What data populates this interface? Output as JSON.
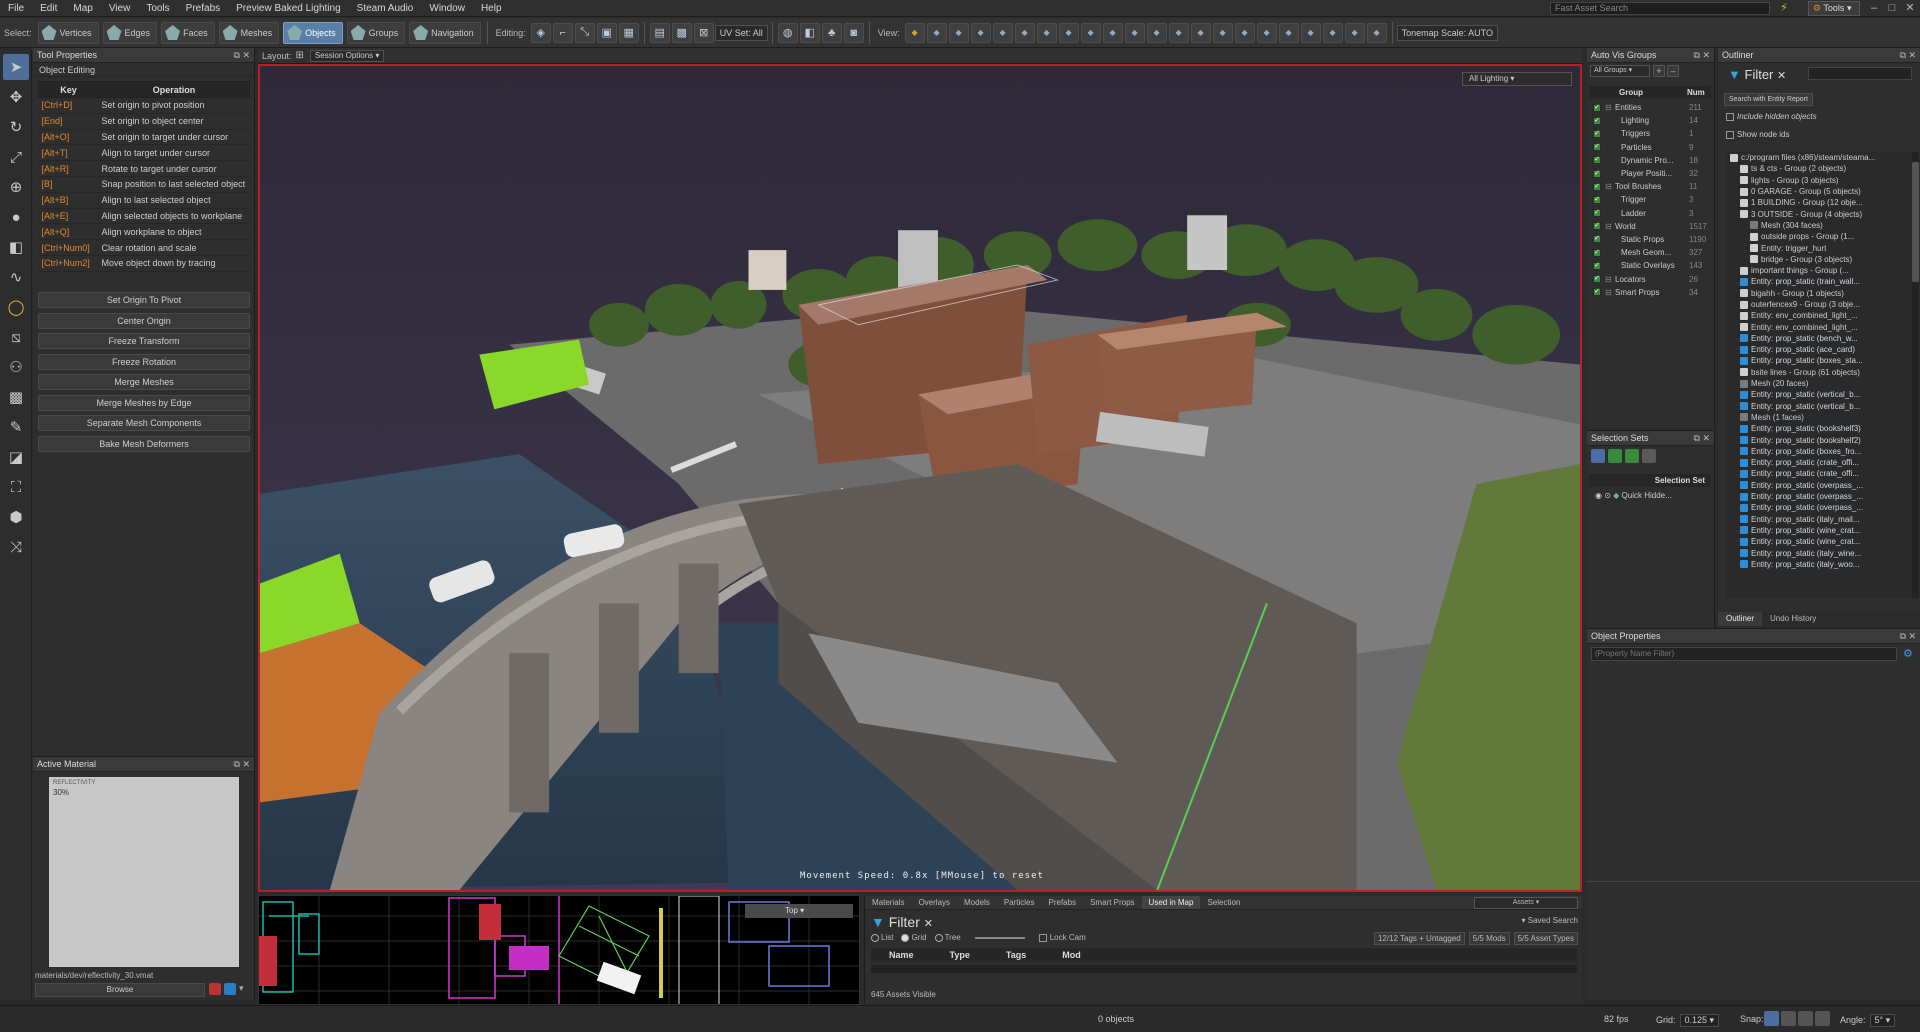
{
  "menu": [
    "File",
    "Edit",
    "Map",
    "View",
    "Tools",
    "Prefabs",
    "Preview Baked Lighting",
    "Steam Audio",
    "Window",
    "Help"
  ],
  "fast_search_placeholder": "Fast Asset Search",
  "tools_label": "Tools",
  "toolbar": {
    "select_label": "Select:",
    "modes": [
      "Vertices",
      "Edges",
      "Faces",
      "Meshes",
      "Objects",
      "Groups",
      "Navigation"
    ],
    "active_mode": "Objects",
    "editing_label": "Editing:",
    "uv_set": "UV Set: All",
    "view_label": "View:",
    "tonemap": "Tonemap Scale: AUTO"
  },
  "tool_properties": {
    "title": "Tool Properties",
    "section": "Object Editing",
    "key_header": "Key",
    "op_header": "Operation",
    "rows": [
      {
        "key": "[Ctrl+D]",
        "op": "Set origin to pivot position"
      },
      {
        "key": "[End]",
        "op": "Set origin to object center"
      },
      {
        "key": "[Alt+O]",
        "op": "Set origin to target under cursor"
      },
      {
        "key": "[Alt+T]",
        "op": "Align to target under cursor"
      },
      {
        "key": "[Alt+R]",
        "op": "Rotate to target under cursor"
      },
      {
        "key": "[B]",
        "op": "Snap position to last selected object"
      },
      {
        "key": "[Alt+B]",
        "op": "Align to last selected object"
      },
      {
        "key": "[Alt+E]",
        "op": "Align selected objects to workplane"
      },
      {
        "key": "[Alt+Q]",
        "op": "Align workplane to object"
      },
      {
        "key": "[Ctrl+Num0]",
        "op": "Clear rotation and scale"
      },
      {
        "key": "[Ctrl+Num2]",
        "op": "Move object down by tracing"
      }
    ],
    "buttons": [
      "Set Origin To Pivot",
      "Center Origin",
      "Freeze Transform",
      "Freeze Rotation",
      "Merge Meshes",
      "Merge Meshes by Edge",
      "Separate Mesh Components",
      "Bake Mesh Deformers"
    ]
  },
  "active_material": {
    "title": "Active Material",
    "preview_name": "REFLECTIVITY",
    "preview_value": "30%",
    "path": "materials/dev/reflectivity_30.vmat",
    "browse": "Browse"
  },
  "viewport": {
    "layout_label": "Layout:",
    "session_options": "Session Options",
    "lighting_mode": "All Lighting",
    "movement_text": "Movement Speed: 0.8x  [MMouse] to reset"
  },
  "minimap": {
    "view": "Top"
  },
  "assets": {
    "tabs": [
      "Materials",
      "Overlays",
      "Models",
      "Particles",
      "Prefabs",
      "Smart Props",
      "Used in Map",
      "Selection"
    ],
    "active_tab": "Used in Map",
    "dropdown": "Assets",
    "filter_label": "Filter",
    "saved_search": "Saved Search",
    "view_modes": [
      "List",
      "Grid",
      "Tree"
    ],
    "lock_cam": "Lock Cam",
    "tags": "12/12 Tags + Untagged",
    "mods": "5/5 Mods",
    "types": "5/5 Asset Types",
    "columns": [
      "Name",
      "Type",
      "Tags",
      "Mod"
    ],
    "count": "645 Assets Visible"
  },
  "auto_vis": {
    "title": "Auto Vis Groups",
    "dropdown": "All Groups",
    "col_group": "Group",
    "col_num": "Num",
    "rows": [
      {
        "name": "Entities",
        "num": "211",
        "indent": 0
      },
      {
        "name": "Lighting",
        "num": "14",
        "indent": 1
      },
      {
        "name": "Triggers",
        "num": "1",
        "indent": 1
      },
      {
        "name": "Particles",
        "num": "9",
        "indent": 1
      },
      {
        "name": "Dynamic Pro...",
        "num": "18",
        "indent": 1
      },
      {
        "name": "Player Positi...",
        "num": "32",
        "indent": 1
      },
      {
        "name": "Tool Brushes",
        "num": "11",
        "indent": 0
      },
      {
        "name": "Trigger",
        "num": "3",
        "indent": 1
      },
      {
        "name": "Ladder",
        "num": "3",
        "indent": 1
      },
      {
        "name": "World",
        "num": "1517",
        "indent": 0
      },
      {
        "name": "Static Props",
        "num": "1190",
        "indent": 1
      },
      {
        "name": "Mesh Geom...",
        "num": "327",
        "indent": 1
      },
      {
        "name": "Static Overlays",
        "num": "143",
        "indent": 1
      },
      {
        "name": "Locators",
        "num": "26",
        "indent": 0
      },
      {
        "name": "Smart Props",
        "num": "34",
        "indent": 0
      }
    ]
  },
  "selection_sets": {
    "title": "Selection Sets",
    "header": "Selection Set",
    "row": "Quick Hidde..."
  },
  "outliner": {
    "title": "Outliner",
    "filter_label": "Filter",
    "report_btn": "Search with Entity Report",
    "opt_hidden": "Include hidden objects",
    "opt_nodeids": "Show node ids",
    "tabs": [
      "Outliner",
      "Undo History"
    ],
    "rows": [
      {
        "t": "c:/program files (x86)/steam/steama...",
        "i": 0,
        "c": "#888"
      },
      {
        "t": "ts & cts - Group (2 objects)",
        "i": 1,
        "c": "#ddd"
      },
      {
        "t": "lights - Group (3 objects)",
        "i": 1,
        "c": "#ddd"
      },
      {
        "t": "0 GARAGE - Group (5 objects)",
        "i": 1,
        "c": "#ddd"
      },
      {
        "t": "1 BUILDING - Group (12 obje...",
        "i": 1,
        "c": "#ddd"
      },
      {
        "t": "3 OUTSIDE - Group (4 objects)",
        "i": 1,
        "c": "#ddd"
      },
      {
        "t": "Mesh (304 faces)",
        "i": 2,
        "c": "#9a9a9a"
      },
      {
        "t": "outside props - Group (1...",
        "i": 2,
        "c": "#ddd"
      },
      {
        "t": "Entity: trigger_hurt",
        "i": 2,
        "c": "#ddd"
      },
      {
        "t": "bridge - Group (3 objects)",
        "i": 2,
        "c": "#ddd"
      },
      {
        "t": "important things - Group (...",
        "i": 1,
        "c": "#ddd"
      },
      {
        "t": "Entity: prop_static (train_wall...",
        "i": 1,
        "c": "#2a8fd6"
      },
      {
        "t": "bigahh - Group (1 objects)",
        "i": 1,
        "c": "#ddd"
      },
      {
        "t": "outerfencex9 - Group (3 obje...",
        "i": 1,
        "c": "#ddd"
      },
      {
        "t": "Entity: env_combined_light_...",
        "i": 1,
        "c": "#ddd"
      },
      {
        "t": "Entity: env_combined_light_...",
        "i": 1,
        "c": "#ddd"
      },
      {
        "t": "Entity: prop_static (bench_w...",
        "i": 1,
        "c": "#2a8fd6"
      },
      {
        "t": "Entity: prop_static (ace_card)",
        "i": 1,
        "c": "#2a8fd6"
      },
      {
        "t": "Entity: prop_static (boxes_sta...",
        "i": 1,
        "c": "#2a8fd6"
      },
      {
        "t": "bsite lines - Group (61 objects)",
        "i": 1,
        "c": "#ddd"
      },
      {
        "t": "Mesh (20 faces)",
        "i": 1,
        "c": "#9a9a9a"
      },
      {
        "t": "Entity: prop_static (vertical_b...",
        "i": 1,
        "c": "#2a8fd6"
      },
      {
        "t": "Entity: prop_static (vertical_b...",
        "i": 1,
        "c": "#2a8fd6"
      },
      {
        "t": "Mesh (1 faces)",
        "i": 1,
        "c": "#9a9a9a"
      },
      {
        "t": "Entity: prop_static (bookshelf3)",
        "i": 1,
        "c": "#2a8fd6"
      },
      {
        "t": "Entity: prop_static (bookshelf2)",
        "i": 1,
        "c": "#2a8fd6"
      },
      {
        "t": "Entity: prop_static (boxes_fro...",
        "i": 1,
        "c": "#2a8fd6"
      },
      {
        "t": "Entity: prop_static (crate_offi...",
        "i": 1,
        "c": "#2a8fd6"
      },
      {
        "t": "Entity: prop_static (crate_offi...",
        "i": 1,
        "c": "#2a8fd6"
      },
      {
        "t": "Entity: prop_static (overpass_...",
        "i": 1,
        "c": "#2a8fd6"
      },
      {
        "t": "Entity: prop_static (overpass_...",
        "i": 1,
        "c": "#2a8fd6"
      },
      {
        "t": "Entity: prop_static (overpass_...",
        "i": 1,
        "c": "#2a8fd6"
      },
      {
        "t": "Entity: prop_static (italy_mail...",
        "i": 1,
        "c": "#2a8fd6"
      },
      {
        "t": "Entity: prop_static (wine_crat...",
        "i": 1,
        "c": "#2a8fd6"
      },
      {
        "t": "Entity: prop_static (wine_crat...",
        "i": 1,
        "c": "#2a8fd6"
      },
      {
        "t": "Entity: prop_static (italy_wine...",
        "i": 1,
        "c": "#2a8fd6"
      },
      {
        "t": "Entity: prop_static (italy_woo...",
        "i": 1,
        "c": "#2a8fd6"
      }
    ]
  },
  "object_properties": {
    "title": "Object Properties",
    "filter_placeholder": "(Property Name Filter)"
  },
  "status": {
    "objects": "0 objects",
    "fps": "82 fps",
    "grid_label": "Grid:",
    "grid_value": "0.125",
    "snap_label": "Snap:",
    "angle_label": "Angle:",
    "angle_value": "5°"
  }
}
